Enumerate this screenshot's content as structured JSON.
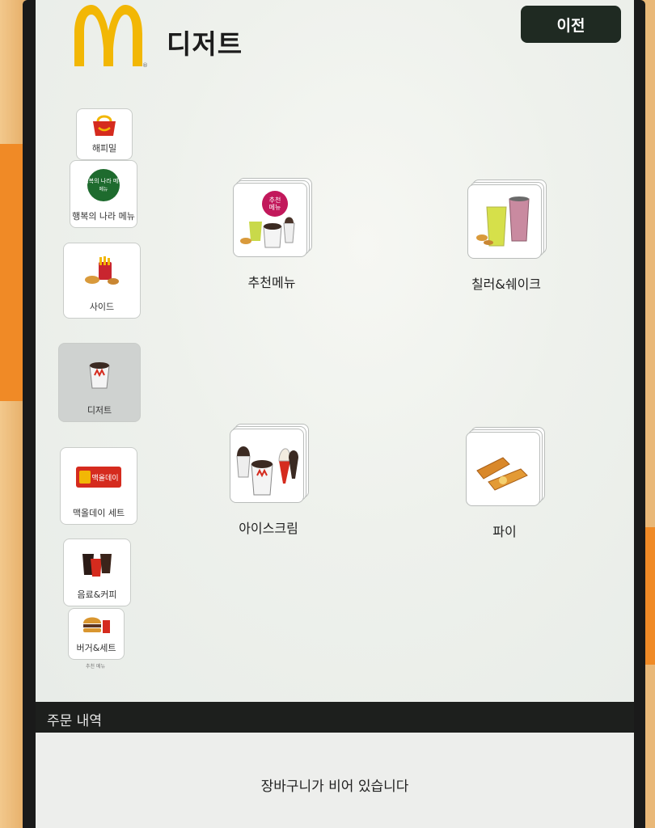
{
  "header": {
    "title": "디저트",
    "prev_label": "이전",
    "logo_icon": "mcdonalds-golden-arches-icon"
  },
  "sidebar": {
    "items": [
      {
        "label": "해피밀",
        "icon": "happy-meal-box-icon"
      },
      {
        "label": "행복의 나라 메뉴",
        "icon": "happy-land-menu-badge-icon",
        "badge_text": "행복의 나라 메뉴"
      },
      {
        "label": "사이드",
        "icon": "fries-nuggets-icon"
      },
      {
        "label": "디저트",
        "icon": "mcflurry-cup-icon",
        "selected": true
      },
      {
        "label": "맥올데이 세트",
        "icon": "mcallday-banner-icon",
        "badge_text": "맥올데이"
      },
      {
        "label": "음료&커피",
        "icon": "drinks-coffee-icon"
      },
      {
        "label": "버거&세트",
        "icon": "burger-set-icon"
      },
      {
        "label": "추천 메뉴",
        "icon": ""
      }
    ]
  },
  "main": {
    "tiles": [
      {
        "label": "추천메뉴",
        "icon": "recommended-menu-icon",
        "badge_text": "추천메뉴"
      },
      {
        "label": "칠러&쉐이크",
        "icon": "chiller-shake-icon"
      },
      {
        "label": "아이스크림",
        "icon": "ice-cream-icon"
      },
      {
        "label": "파이",
        "icon": "pie-icon"
      }
    ]
  },
  "order": {
    "header_label": "주문 내역",
    "empty_message": "장바구니가 비어 있습니다"
  },
  "colors": {
    "brand_yellow": "#f2b705",
    "brand_red": "#d52b1e",
    "button_dark": "#1f2a22"
  }
}
